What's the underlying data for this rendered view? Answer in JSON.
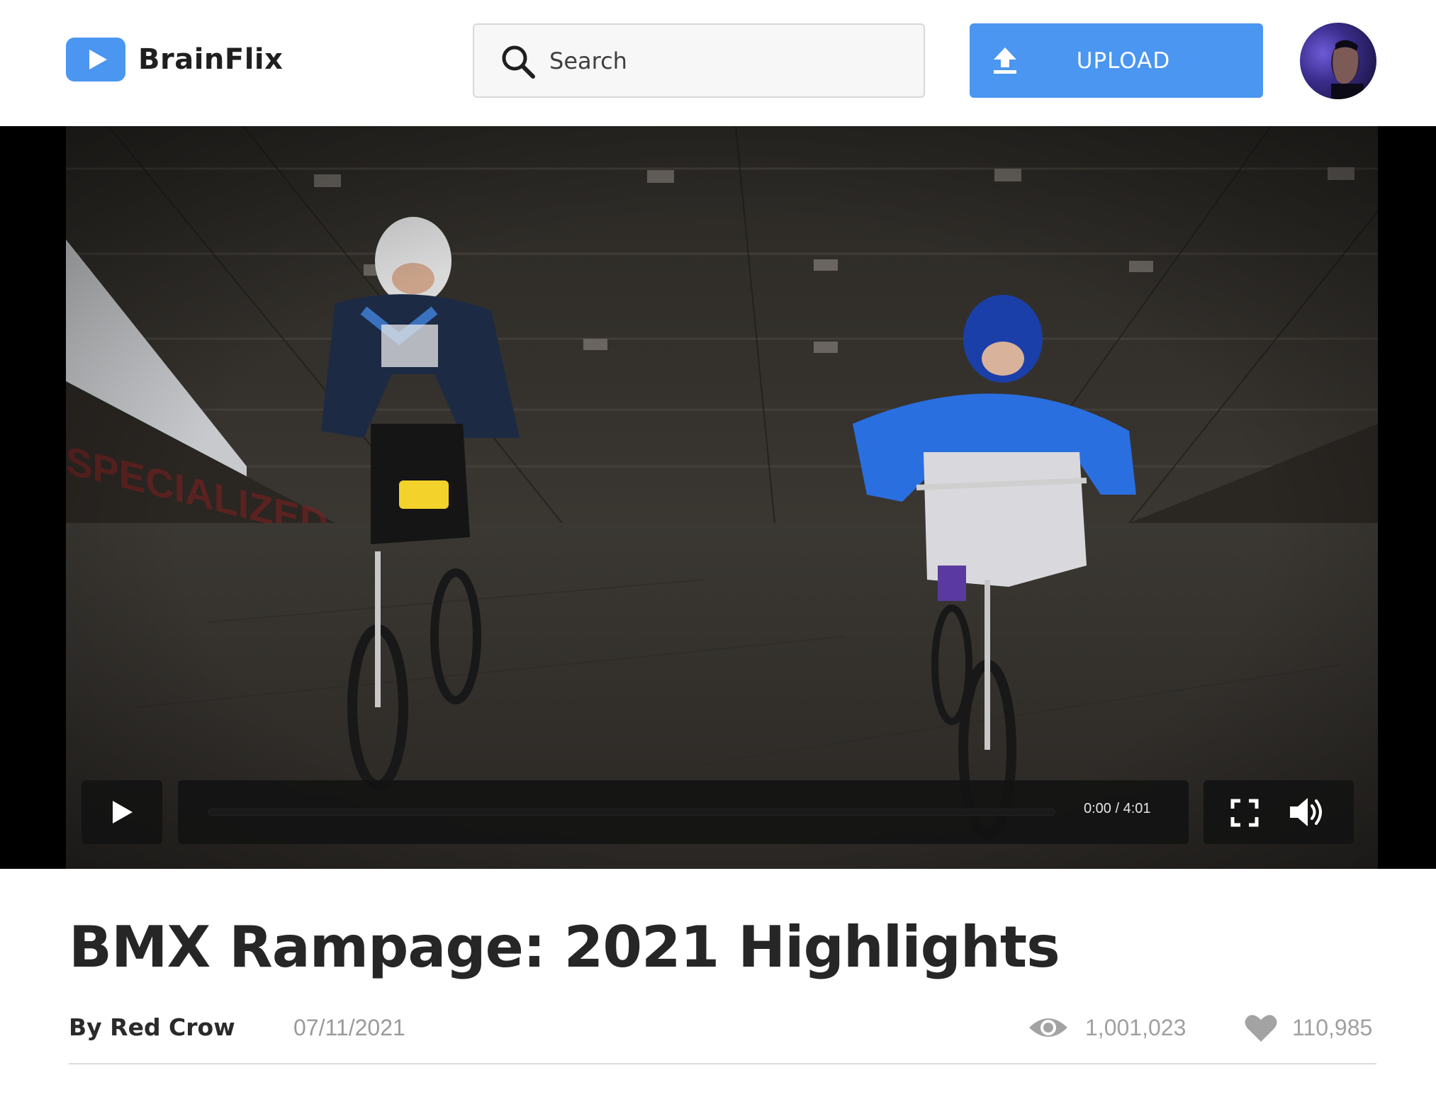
{
  "app": {
    "name": "BrainFlix"
  },
  "header": {
    "search": {
      "placeholder": "Search",
      "value": ""
    },
    "upload_label": "UPLOAD"
  },
  "video": {
    "current_time": "0:00",
    "duration": "4:01",
    "time_display": "0:00 / 4:01",
    "progress_fraction": 0
  },
  "details": {
    "title": "BMX Rampage: 2021 Highlights",
    "author": "By Red Crow",
    "date": "07/11/2021",
    "views": "1,001,023",
    "likes": "110,985"
  },
  "colors": {
    "accent": "#4a96f0",
    "text_dark": "#262626",
    "text_muted": "#a0a0a0",
    "divider": "#dcdcdc"
  },
  "icons": {
    "logo": "play-icon",
    "search": "search-icon",
    "upload": "upload-icon",
    "play": "play-icon",
    "fullscreen": "fullscreen-icon",
    "volume": "volume-icon",
    "views": "eye-icon",
    "likes": "heart-icon"
  }
}
